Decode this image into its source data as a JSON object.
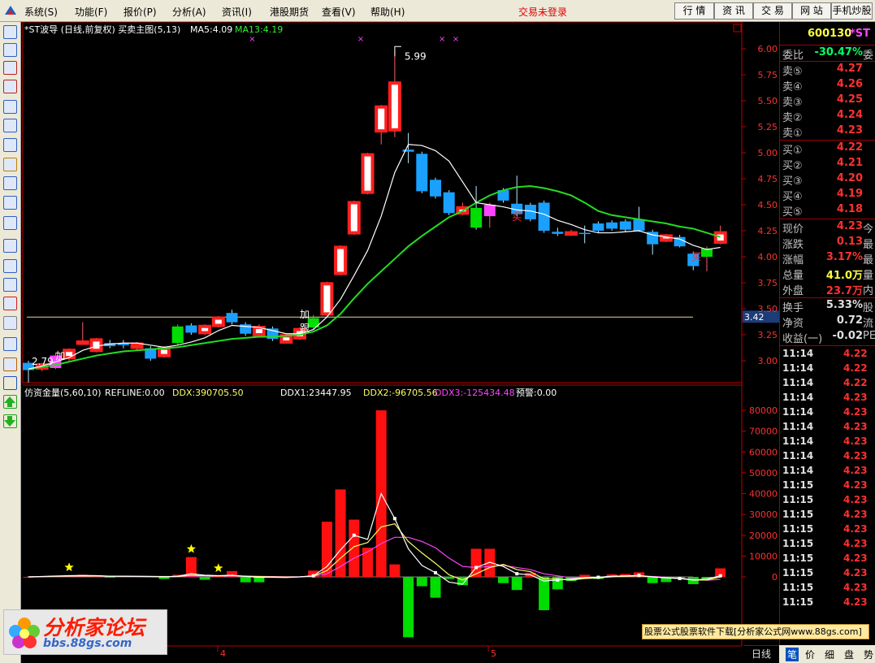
{
  "menu": {
    "items": [
      "系统(S)",
      "功能(F)",
      "报价(P)",
      "分析(A)",
      "资讯(I)",
      "港股期货",
      "查看(V)",
      "帮助(H)"
    ],
    "login_status": "交易未登录",
    "top_buttons": [
      "行 情",
      "资 讯",
      "交 易",
      "网 站",
      "手机炒股"
    ]
  },
  "toolbar_icons": [
    "quote-icon",
    "list-icon",
    "candlestick-icon",
    "bar-chart-icon",
    "multi-window-icon",
    "table-icon",
    "report-icon",
    "users-icon",
    "f10-icon",
    "search-icon",
    "eit-icon",
    "macd-icon",
    "rsi-icon",
    "calculator-icon",
    "dollar-icon",
    "link-icon",
    "export-icon",
    "pencil-icon",
    "move-icon",
    "up-arrow-icon",
    "down-arrow-icon"
  ],
  "main_header": {
    "title": "*ST波导 (日线,前复权) 买卖主图(5,13)",
    "ma5": "MA5:4.09",
    "ma13": "MA13:4.19"
  },
  "sub_header": {
    "title": "仿资金量(5,60,10)",
    "refline": "REFLINE:0.00",
    "ddx": "DDX:390705.50",
    "ddx1": "DDX1:23447.95",
    "ddx2": "DDX2:-96705.56",
    "ddx3": "DDX3:-125434.48",
    "warn": "预警:0.00"
  },
  "annotations": {
    "high": "5.99",
    "low": "2.79",
    "hline_value": "3.42",
    "jia1": "加",
    "jia2": "加",
    "gen": "跟",
    "mai1": "买",
    "mai2": "买"
  },
  "x_labels": [
    "4",
    "5"
  ],
  "colors": {
    "up": "#ff2020",
    "down": "#1aa0ff",
    "up_alt": "#ff44ff",
    "down_alt": "#00dd00",
    "ma5": "#ffffff",
    "ma13": "#22dd22",
    "hline": "#e8d890",
    "axis": "#c00000",
    "ddx1": "#ffffff",
    "ddx2": "#ffff66",
    "ddx3": "#ff44ff"
  },
  "chart_data": [
    {
      "type": "candlestick",
      "title": "*ST波导 (日线,前复权) 买卖主图(5,13)",
      "ylim": [
        2.75,
        6.15
      ],
      "yticks": [
        "3.00",
        "3.25",
        "3.50",
        "3.75",
        "4.00",
        "4.25",
        "4.50",
        "4.75",
        "5.00",
        "5.25",
        "5.50",
        "5.75",
        "6.00"
      ],
      "reference_line": 3.42,
      "candles": [
        {
          "o": 2.98,
          "c": 2.91,
          "h": 3.0,
          "l": 2.79
        },
        {
          "o": 2.93,
          "c": 2.96,
          "h": 2.98,
          "l": 2.9
        },
        {
          "o": 2.93,
          "c": 3.05,
          "h": 3.08,
          "l": 2.92
        },
        {
          "o": 3.03,
          "c": 3.1,
          "h": 3.12,
          "l": 3.0
        },
        {
          "o": 3.18,
          "c": 3.18,
          "h": 3.37,
          "l": 3.16
        },
        {
          "o": 3.1,
          "c": 3.2,
          "h": 3.22,
          "l": 3.08
        },
        {
          "o": 3.17,
          "c": 3.14,
          "h": 3.2,
          "l": 3.12
        },
        {
          "o": 3.17,
          "c": 3.15,
          "h": 3.2,
          "l": 3.12
        },
        {
          "o": 3.13,
          "c": 3.16,
          "h": 3.18,
          "l": 3.1
        },
        {
          "o": 3.12,
          "c": 3.02,
          "h": 3.14,
          "l": 3.0
        },
        {
          "o": 3.05,
          "c": 3.12,
          "h": 3.14,
          "l": 3.03
        },
        {
          "o": 3.17,
          "c": 3.33,
          "h": 3.35,
          "l": 3.15
        },
        {
          "o": 3.34,
          "c": 3.27,
          "h": 3.36,
          "l": 3.25
        },
        {
          "o": 3.27,
          "c": 3.33,
          "h": 3.35,
          "l": 3.25
        },
        {
          "o": 3.34,
          "c": 3.41,
          "h": 3.43,
          "l": 3.32
        },
        {
          "o": 3.46,
          "c": 3.37,
          "h": 3.49,
          "l": 3.35
        },
        {
          "o": 3.35,
          "c": 3.26,
          "h": 3.37,
          "l": 3.24
        },
        {
          "o": 3.25,
          "c": 3.32,
          "h": 3.35,
          "l": 3.24
        },
        {
          "o": 3.31,
          "c": 3.21,
          "h": 3.33,
          "l": 3.19
        },
        {
          "o": 3.18,
          "c": 3.24,
          "h": 3.26,
          "l": 3.17
        },
        {
          "o": 3.22,
          "c": 3.3,
          "h": 3.32,
          "l": 3.2
        },
        {
          "o": 3.32,
          "c": 3.41,
          "h": 3.44,
          "l": 3.3
        },
        {
          "o": 3.45,
          "c": 3.74,
          "h": 3.76,
          "l": 3.43
        },
        {
          "o": 3.84,
          "c": 4.09,
          "h": 4.11,
          "l": 3.82
        },
        {
          "o": 4.23,
          "c": 4.52,
          "h": 4.54,
          "l": 4.21
        },
        {
          "o": 4.62,
          "c": 4.98,
          "h": 5.0,
          "l": 4.6
        },
        {
          "o": 5.21,
          "c": 5.44,
          "h": 5.46,
          "l": 5.08
        },
        {
          "o": 5.22,
          "c": 5.67,
          "h": 5.99,
          "l": 5.15
        },
        {
          "o": 5.03,
          "c": 5.01,
          "h": 5.19,
          "l": 4.9
        },
        {
          "o": 4.99,
          "c": 4.63,
          "h": 5.01,
          "l": 4.61
        },
        {
          "o": 4.74,
          "c": 4.58,
          "h": 4.76,
          "l": 4.56
        },
        {
          "o": 4.62,
          "c": 4.42,
          "h": 4.64,
          "l": 4.4
        },
        {
          "o": 4.42,
          "c": 4.47,
          "h": 4.52,
          "l": 4.4
        },
        {
          "o": 4.47,
          "c": 4.28,
          "h": 4.68,
          "l": 4.26
        },
        {
          "o": 4.39,
          "c": 4.5,
          "h": 4.52,
          "l": 4.28
        },
        {
          "o": 4.64,
          "c": 4.54,
          "h": 4.66,
          "l": 4.52
        },
        {
          "o": 4.51,
          "c": 4.41,
          "h": 4.78,
          "l": 4.39
        },
        {
          "o": 4.5,
          "c": 4.36,
          "h": 4.52,
          "l": 4.34
        },
        {
          "o": 4.52,
          "c": 4.25,
          "h": 4.54,
          "l": 4.23
        },
        {
          "o": 4.24,
          "c": 4.22,
          "h": 4.28,
          "l": 4.2
        },
        {
          "o": 4.22,
          "c": 4.23,
          "h": 4.26,
          "l": 4.2
        },
        {
          "o": 4.23,
          "c": 4.22,
          "h": 4.3,
          "l": 4.13
        },
        {
          "o": 4.32,
          "c": 4.25,
          "h": 4.34,
          "l": 4.23
        },
        {
          "o": 4.33,
          "c": 4.27,
          "h": 4.35,
          "l": 4.25
        },
        {
          "o": 4.34,
          "c": 4.26,
          "h": 4.36,
          "l": 4.24
        },
        {
          "o": 4.36,
          "c": 4.25,
          "h": 4.48,
          "l": 4.24
        },
        {
          "o": 4.24,
          "c": 4.12,
          "h": 4.26,
          "l": 4.02
        },
        {
          "o": 4.16,
          "c": 4.2,
          "h": 4.22,
          "l": 4.14
        },
        {
          "o": 4.19,
          "c": 4.1,
          "h": 4.21,
          "l": 4.09
        },
        {
          "o": 4.03,
          "c": 3.91,
          "h": 4.05,
          "l": 3.87
        },
        {
          "o": 4.0,
          "c": 4.08,
          "h": 4.1,
          "l": 3.86
        },
        {
          "o": 4.14,
          "c": 4.23,
          "h": 4.3,
          "l": 4.12
        }
      ],
      "ma5": [
        2.92,
        2.95,
        2.99,
        3.03,
        3.1,
        3.14,
        3.16,
        3.17,
        3.17,
        3.15,
        3.13,
        3.15,
        3.18,
        3.22,
        3.29,
        3.34,
        3.33,
        3.32,
        3.29,
        3.26,
        3.26,
        3.3,
        3.42,
        3.59,
        3.82,
        4.06,
        4.39,
        4.81,
        5.08,
        5.07,
        5.02,
        4.92,
        4.72,
        4.52,
        4.5,
        4.48,
        4.45,
        4.44,
        4.41,
        4.35,
        4.31,
        4.26,
        4.23,
        4.23,
        4.24,
        4.25,
        4.21,
        4.19,
        4.17,
        4.11,
        4.07,
        4.09
      ],
      "ma13": [
        2.92,
        2.94,
        2.96,
        2.99,
        3.02,
        3.05,
        3.07,
        3.09,
        3.1,
        3.11,
        3.12,
        3.13,
        3.15,
        3.17,
        3.19,
        3.21,
        3.22,
        3.23,
        3.23,
        3.24,
        3.25,
        3.28,
        3.34,
        3.45,
        3.6,
        3.74,
        3.86,
        3.98,
        4.1,
        4.2,
        4.29,
        4.38,
        4.44,
        4.52,
        4.59,
        4.64,
        4.67,
        4.68,
        4.66,
        4.63,
        4.59,
        4.52,
        4.44,
        4.4,
        4.38,
        4.36,
        4.34,
        4.32,
        4.29,
        4.27,
        4.23,
        4.19
      ]
    },
    {
      "type": "bar",
      "title": "仿资金量(5,60,10)",
      "ylim": [
        -30000,
        82000
      ],
      "yticks": [
        "0",
        "10000",
        "20000",
        "30000",
        "40000",
        "50000",
        "60000",
        "70000",
        "80000"
      ],
      "values": [
        0,
        300,
        600,
        700,
        1000,
        800,
        -300,
        500,
        300,
        400,
        -1000,
        1000,
        9500,
        -1400,
        300,
        2800,
        -2600,
        -2600,
        -300,
        -200,
        200,
        3000,
        26500,
        42000,
        27500,
        14000,
        80000,
        6000,
        -29000,
        -4500,
        -10000,
        -1000,
        -4000,
        13500,
        13500,
        -3000,
        -6300,
        2000,
        -16000,
        -6000,
        -2000,
        1000,
        -1000,
        1200,
        1400,
        2200,
        -3000,
        -2500,
        -1000,
        -3500,
        -1000,
        4100
      ],
      "ddx1": [
        0,
        200,
        400,
        600,
        700,
        600,
        300,
        300,
        200,
        150,
        0,
        300,
        1500,
        800,
        600,
        800,
        200,
        -200,
        -200,
        -300,
        0,
        500,
        5000,
        13000,
        20000,
        18000,
        40000,
        28000,
        13500,
        5500,
        2000,
        -2500,
        -3500,
        4500,
        7000,
        5000,
        1500,
        1000,
        -2000,
        -1500,
        -1000,
        -400,
        -200,
        300,
        500,
        700,
        0,
        -500,
        -800,
        -1500,
        -1000,
        500
      ],
      "ddx2": [
        0,
        100,
        300,
        400,
        500,
        450,
        350,
        300,
        250,
        200,
        100,
        200,
        800,
        600,
        500,
        600,
        300,
        100,
        0,
        -100,
        0,
        400,
        3000,
        9000,
        14500,
        16500,
        24000,
        25500,
        17000,
        11500,
        6500,
        1000,
        -1500,
        1500,
        4500,
        6000,
        3500,
        2500,
        -1000,
        -1000,
        -1500,
        -800,
        -500,
        100,
        300,
        500,
        0,
        -400,
        -700,
        -1500,
        -1500,
        0
      ],
      "ddx3": [
        0,
        50,
        150,
        250,
        300,
        330,
        320,
        300,
        280,
        250,
        200,
        250,
        500,
        500,
        450,
        500,
        400,
        250,
        150,
        50,
        100,
        300,
        1500,
        5000,
        9000,
        12000,
        16000,
        19000,
        19000,
        17000,
        14000,
        9000,
        5000,
        4500,
        5000,
        5500,
        4500,
        3500,
        1500,
        500,
        -500,
        -400,
        -300,
        0,
        200,
        400,
        200,
        -200,
        -600,
        -1200,
        -1600,
        -1200
      ],
      "stars": [
        3,
        12,
        14
      ],
      "alert_marks": [
        16,
        24,
        30,
        31
      ]
    }
  ],
  "right_panel": {
    "code": "600130",
    "name": "*ST",
    "ratio_label": "委比",
    "ratio_value": "-30.47%",
    "ratio_cut": "委",
    "asks": [
      {
        "label": "卖⑤",
        "price": "4.27"
      },
      {
        "label": "卖④",
        "price": "4.26"
      },
      {
        "label": "卖③",
        "price": "4.25"
      },
      {
        "label": "卖②",
        "price": "4.24"
      },
      {
        "label": "卖①",
        "price": "4.23"
      }
    ],
    "bids": [
      {
        "label": "买①",
        "price": "4.22"
      },
      {
        "label": "买②",
        "price": "4.21"
      },
      {
        "label": "买③",
        "price": "4.20"
      },
      {
        "label": "买④",
        "price": "4.19"
      },
      {
        "label": "买⑤",
        "price": "4.18"
      }
    ],
    "stats1": [
      {
        "label": "现价",
        "value": "4.23",
        "cut": "今",
        "color": "#ff3030"
      },
      {
        "label": "涨跌",
        "value": "0.13",
        "cut": "最",
        "color": "#ff3030"
      },
      {
        "label": "涨幅",
        "value": "3.17%",
        "cut": "最",
        "color": "#ff3030"
      },
      {
        "label": "总量",
        "value": "41.0万",
        "cut": "量",
        "color": "#ffff40"
      },
      {
        "label": "外盘",
        "value": "23.7万",
        "cut": "内",
        "color": "#ff3030"
      }
    ],
    "stats2": [
      {
        "label": "换手",
        "value": "5.33%",
        "cut": "股",
        "color": "#e0e0e0"
      },
      {
        "label": "净资",
        "value": "0.72",
        "cut": "流",
        "color": "#e0e0e0"
      },
      {
        "label": "收益(一)",
        "value": "-0.02",
        "cut": "PE",
        "color": "#e0e0e0"
      }
    ],
    "ticks": [
      {
        "time": "11:14",
        "price": "4.22"
      },
      {
        "time": "11:14",
        "price": "4.22"
      },
      {
        "time": "11:14",
        "price": "4.22"
      },
      {
        "time": "11:14",
        "price": "4.23"
      },
      {
        "time": "11:14",
        "price": "4.23"
      },
      {
        "time": "11:14",
        "price": "4.23"
      },
      {
        "time": "11:14",
        "price": "4.23"
      },
      {
        "time": "11:14",
        "price": "4.23"
      },
      {
        "time": "11:14",
        "price": "4.23"
      },
      {
        "time": "11:15",
        "price": "4.23"
      },
      {
        "time": "11:15",
        "price": "4.23"
      },
      {
        "time": "11:15",
        "price": "4.23"
      },
      {
        "time": "11:15",
        "price": "4.23"
      },
      {
        "time": "11:15",
        "price": "4.23"
      },
      {
        "time": "11:15",
        "price": "4.23"
      },
      {
        "time": "11:15",
        "price": "4.23"
      },
      {
        "time": "11:15",
        "price": "4.23"
      },
      {
        "time": "11:15",
        "price": "4.23"
      }
    ],
    "tabs": [
      "笔",
      "价",
      "细",
      "盘",
      "势"
    ],
    "day_tab": "日线"
  },
  "watermark": {
    "title": "分析家论坛",
    "url": "bbs.88gs.com"
  },
  "ad_text": "股票公式股票软件下载[分析家公式网www.88gs.com]"
}
